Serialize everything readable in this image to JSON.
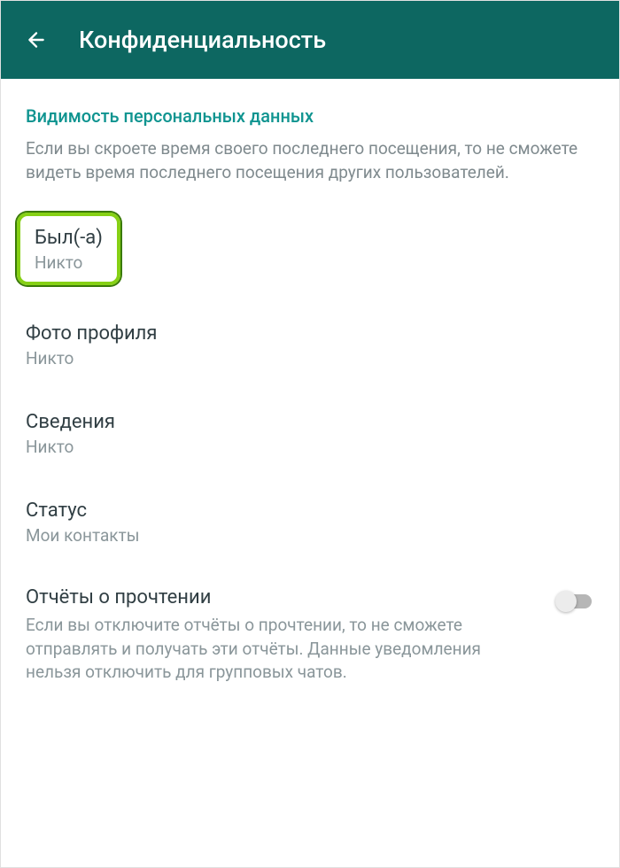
{
  "header": {
    "title": "Конфиденциальность"
  },
  "section": {
    "header": "Видимость персональных данных",
    "description": "Если вы скроете время своего последнего посещения, то не сможете видеть время последнего посещения других пользователей."
  },
  "settings": {
    "last_seen": {
      "label": "Был(-а)",
      "value": "Никто"
    },
    "profile_photo": {
      "label": "Фото профиля",
      "value": "Никто"
    },
    "about": {
      "label": "Сведения",
      "value": "Никто"
    },
    "status": {
      "label": "Статус",
      "value": "Мои контакты"
    }
  },
  "read_receipts": {
    "title": "Отчёты о прочтении",
    "description": "Если вы отключите отчёты о прочтении, то не сможете отправлять и получать эти отчёты. Данные уведомления нельзя отключить для групповых чатов.",
    "enabled": false
  }
}
